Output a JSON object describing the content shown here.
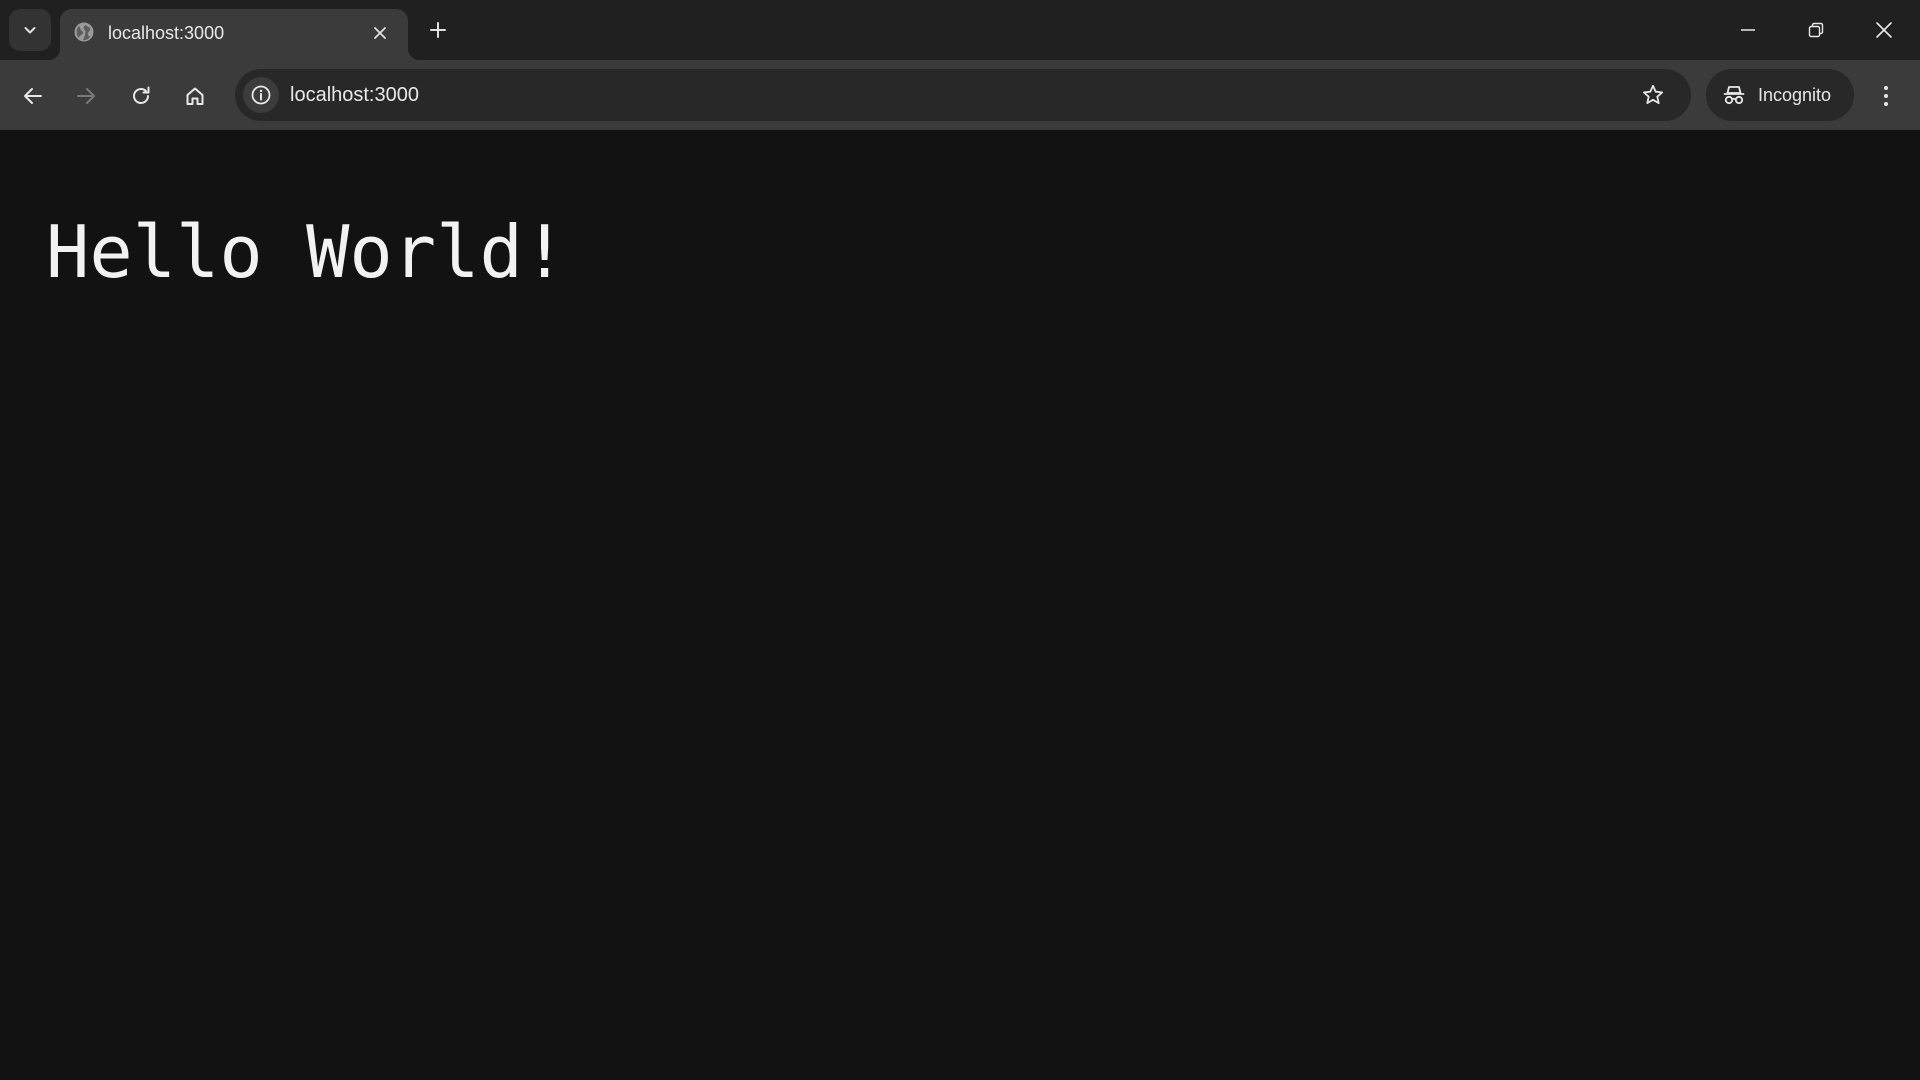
{
  "browser": {
    "tab": {
      "title": "localhost:3000",
      "favicon": "globe-icon"
    },
    "omnibox": {
      "url": "localhost:3000"
    },
    "profile": {
      "label": "Incognito",
      "icon": "incognito-icon"
    },
    "icons": {
      "tab_search": "chevron-down-icon",
      "tab_close": "close-icon",
      "new_tab": "plus-icon",
      "minimize": "minimize-icon",
      "restore": "restore-icon",
      "close_window": "close-icon",
      "back": "arrow-left-icon",
      "forward": "arrow-right-icon",
      "reload": "reload-icon",
      "home": "home-icon",
      "site_info": "info-icon",
      "bookmark": "star-icon",
      "menu": "kebab-menu-icon"
    },
    "colors": {
      "tabstrip_bg": "#202020",
      "toolbar_bg": "#3b3b3b",
      "omnibox_bg": "#282828",
      "page_bg": "#121212",
      "text": "#e8e8e8"
    }
  },
  "page": {
    "heading": "Hello World!"
  }
}
